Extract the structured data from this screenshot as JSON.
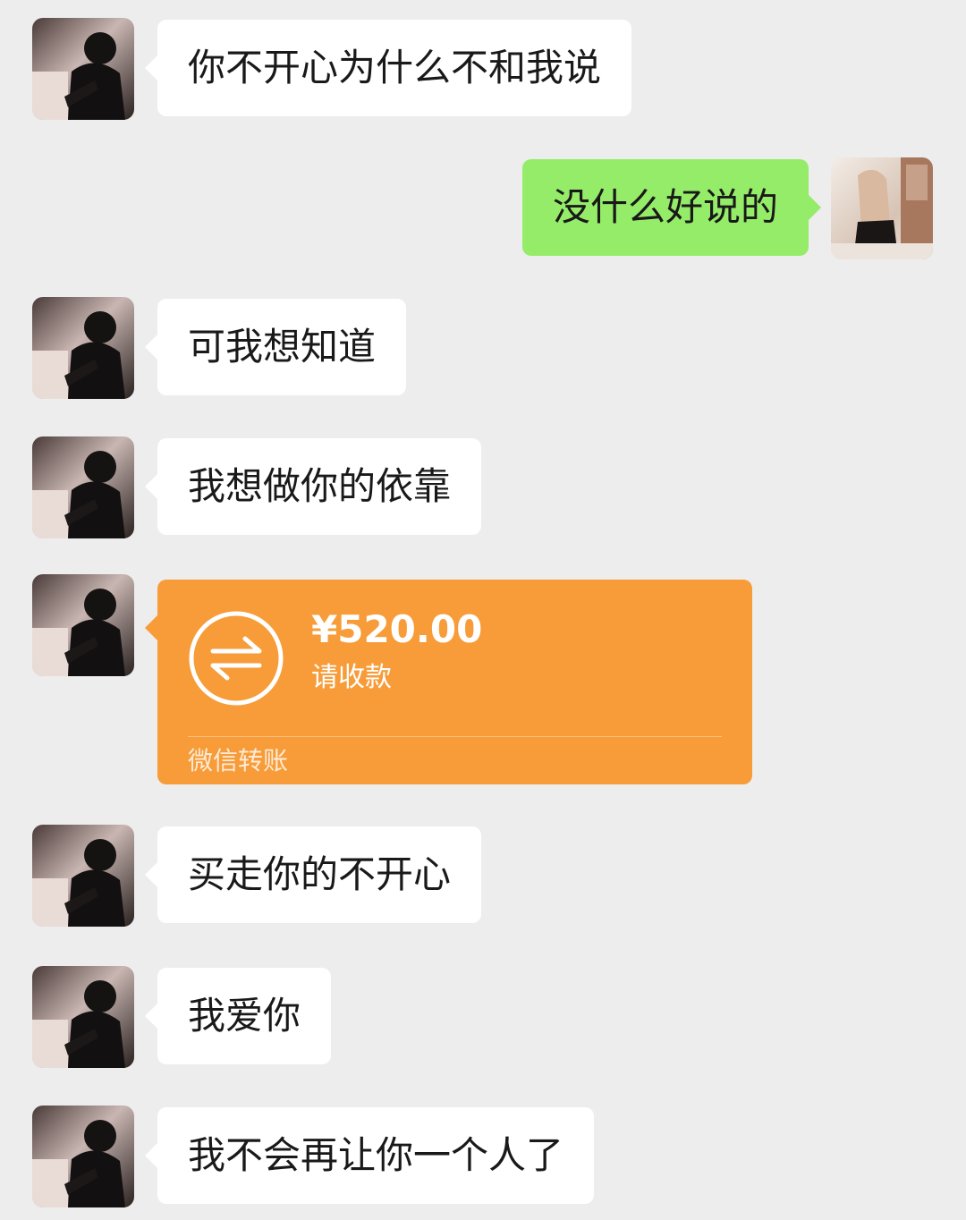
{
  "chat": {
    "messages": [
      {
        "text": "你不开心为什么不和我说"
      },
      {
        "text": "没什么好说的"
      },
      {
        "text": "可我想知道"
      },
      {
        "text": "我想做你的依靠"
      },
      {
        "transfer": {
          "amount": "¥520.00",
          "status": "请收款",
          "footer": "微信转账"
        }
      },
      {
        "text": "买走你的不开心"
      },
      {
        "text": "我爱你"
      },
      {
        "text": "我不会再让你一个人了"
      }
    ]
  },
  "colors": {
    "background": "#ededed",
    "incoming_bubble": "#ffffff",
    "outgoing_bubble": "#95ec69",
    "transfer_card": "#f79c38"
  },
  "icons": {
    "transfer": "transfer-arrows-icon",
    "contact_avatar": "contact-avatar",
    "self_avatar": "self-avatar"
  }
}
